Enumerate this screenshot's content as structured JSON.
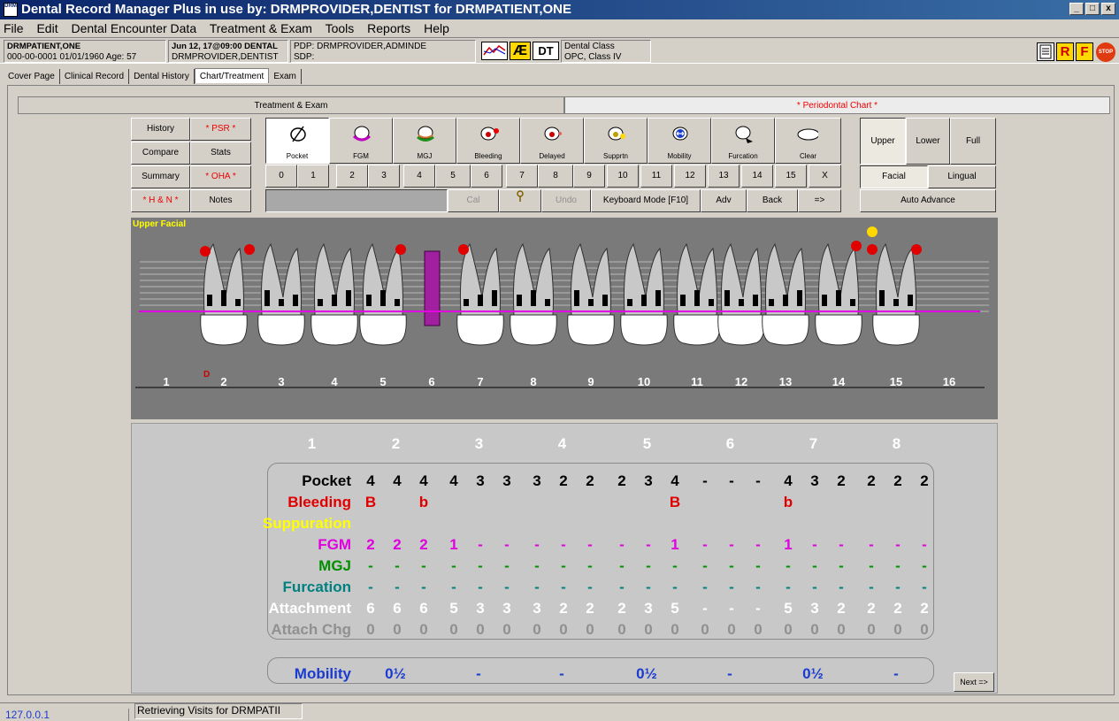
{
  "window": {
    "title": "Dental Record Manager Plus in use by: DRMPROVIDER,DENTIST for DRMPATIENT,ONE",
    "icon_text": "DRM"
  },
  "menu": [
    "File",
    "Edit",
    "Dental Encounter Data",
    "Treatment & Exam",
    "Tools",
    "Reports",
    "Help"
  ],
  "patient": {
    "name": "DRMPATIENT,ONE",
    "id_line": "000-00-0001   01/01/1960 Age: 57",
    "visit": "Jun 12, 17@09:00 DENTAL",
    "provider": "DRMPROVIDER,DENTIST",
    "pdp": "PDP: DRMPROVIDER,ADMINDE",
    "sdp": "SDP:",
    "dental_class": "Dental Class",
    "class_detail": "OPC, Class IV",
    "toolbar_icons": [
      "Æ",
      "DT",
      "R",
      "F",
      "STOP"
    ]
  },
  "tabs": [
    "Cover Page",
    "Clinical Record",
    "Dental History",
    "Chart/Treatment",
    "Exam"
  ],
  "subtabs": {
    "left": "Treatment & Exam",
    "right": "* Periodontal Chart *"
  },
  "left_buttons": [
    [
      "History",
      "* PSR *"
    ],
    [
      "Compare",
      "Stats"
    ],
    [
      "Summary",
      "* OHA *"
    ],
    [
      "* H & N *",
      "Notes"
    ]
  ],
  "tools": [
    "Pocket",
    "FGM",
    "MGJ",
    "Bleeding",
    "Delayed",
    "Supprtn",
    "Mobility",
    "Furcation",
    "Clear"
  ],
  "numbers": [
    "0",
    "1",
    "2",
    "3",
    "4",
    "5",
    "6",
    "7",
    "8",
    "9",
    "10",
    "11",
    "12",
    "13",
    "14",
    "15",
    "X"
  ],
  "action_buttons": [
    "Cal",
    "Undo",
    "Keyboard Mode [F10]",
    "Adv",
    "Back",
    "=>"
  ],
  "right_panel": {
    "upper": "Upper",
    "lower": "Lower",
    "full": "Full",
    "facial": "Facial",
    "lingual": "Lingual",
    "auto": "Auto Advance"
  },
  "chart": {
    "label": "Upper Facial",
    "teeth": [
      "1",
      "2",
      "3",
      "4",
      "5",
      "6",
      "7",
      "8",
      "9",
      "10",
      "11",
      "12",
      "13",
      "14",
      "15",
      "16"
    ],
    "marker_d": "D"
  },
  "grid": {
    "row_labels": [
      "Pocket",
      "Bleeding",
      "Suppuration",
      "FGM",
      "MGJ",
      "Furcation",
      "Attachment",
      "Attach Chg"
    ],
    "row_colors": [
      "#000000",
      "#e00000",
      "#ffff00",
      "#e000e0",
      "#009000",
      "#008080",
      "#ffffff",
      "#909090"
    ],
    "columns": [
      "1",
      "2",
      "3",
      "4",
      "5",
      "6",
      "7",
      "8"
    ],
    "pocket": [
      [
        "",
        "",
        ""
      ],
      [
        "4",
        "4",
        "4"
      ],
      [
        "4",
        "3",
        "3"
      ],
      [
        "3",
        "2",
        "2"
      ],
      [
        "2",
        "3",
        "4"
      ],
      [
        "-",
        "-",
        "-"
      ],
      [
        "4",
        "3",
        "2"
      ],
      [
        "2",
        "2",
        "2"
      ]
    ],
    "bleeding": [
      [
        "",
        "",
        ""
      ],
      [
        "B",
        "",
        "b"
      ],
      [
        "",
        "",
        ""
      ],
      [
        "",
        "",
        ""
      ],
      [
        "",
        "",
        "B"
      ],
      [
        "",
        "",
        ""
      ],
      [
        "b",
        "",
        ""
      ],
      [
        "",
        "",
        ""
      ]
    ],
    "fgm": [
      [
        "",
        "",
        ""
      ],
      [
        "2",
        "2",
        "2"
      ],
      [
        "1",
        "-",
        "-"
      ],
      [
        "-",
        "-",
        "-"
      ],
      [
        "-",
        "-",
        "1"
      ],
      [
        "-",
        "-",
        "-"
      ],
      [
        "1",
        "-",
        "-"
      ],
      [
        "-",
        "-",
        "-"
      ]
    ],
    "mgj": [
      [
        "",
        "",
        ""
      ],
      [
        "-",
        "-",
        "-"
      ],
      [
        "-",
        "-",
        "-"
      ],
      [
        "-",
        "-",
        "-"
      ],
      [
        "-",
        "-",
        "-"
      ],
      [
        "-",
        "-",
        "-"
      ],
      [
        "-",
        "-",
        "-"
      ],
      [
        "-",
        "-",
        "-"
      ]
    ],
    "furcation": [
      [
        "",
        "",
        ""
      ],
      [
        "-",
        "-",
        "-"
      ],
      [
        "-",
        "-",
        "-"
      ],
      [
        "-",
        "-",
        "-"
      ],
      [
        "-",
        "-",
        "-"
      ],
      [
        "-",
        "-",
        "-"
      ],
      [
        "-",
        "-",
        "-"
      ],
      [
        "-",
        "-",
        "-"
      ]
    ],
    "attachment": [
      [
        "",
        "",
        ""
      ],
      [
        "6",
        "6",
        "6"
      ],
      [
        "5",
        "3",
        "3"
      ],
      [
        "3",
        "2",
        "2"
      ],
      [
        "2",
        "3",
        "5"
      ],
      [
        "-",
        "-",
        "-"
      ],
      [
        "5",
        "3",
        "2"
      ],
      [
        "2",
        "2",
        "2"
      ]
    ],
    "attach_chg": [
      [
        "",
        "",
        ""
      ],
      [
        "0",
        "0",
        "0"
      ],
      [
        "0",
        "0",
        "0"
      ],
      [
        "0",
        "0",
        "0"
      ],
      [
        "0",
        "0",
        "0"
      ],
      [
        "0",
        "0",
        "0"
      ],
      [
        "0",
        "0",
        "0"
      ],
      [
        "0",
        "0",
        "0"
      ]
    ],
    "mobility_label": "Mobility",
    "mobility": [
      "",
      "0½",
      "-",
      "-",
      "0½",
      "-",
      "0½",
      "-"
    ],
    "next": "Next =>"
  },
  "status": {
    "ip": "127.0.0.1",
    "message": "Retrieving Visits for DRMPATII"
  }
}
